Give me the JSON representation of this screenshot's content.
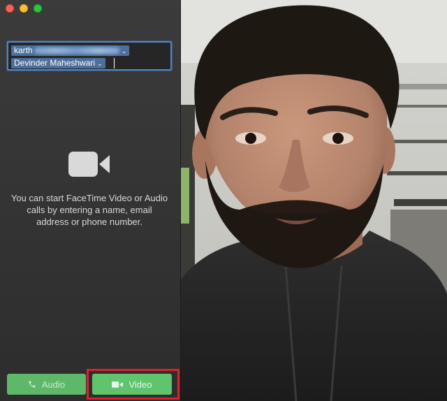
{
  "window": {
    "controls": [
      "close",
      "minimize",
      "maximize"
    ]
  },
  "to_field": {
    "recipient_1": "karth",
    "recipient_2": "Devinder Maheshwari"
  },
  "empty_state": {
    "icon": "video-camera-icon",
    "message": "You can start FaceTime Video or Audio calls by entering a name, email address or phone number."
  },
  "buttons": {
    "audio_label": "Audio",
    "video_label": "Video"
  },
  "colors": {
    "accent_green": "#5fc46d",
    "highlight_red": "#e0202a",
    "focus_blue": "#4d86c4"
  }
}
